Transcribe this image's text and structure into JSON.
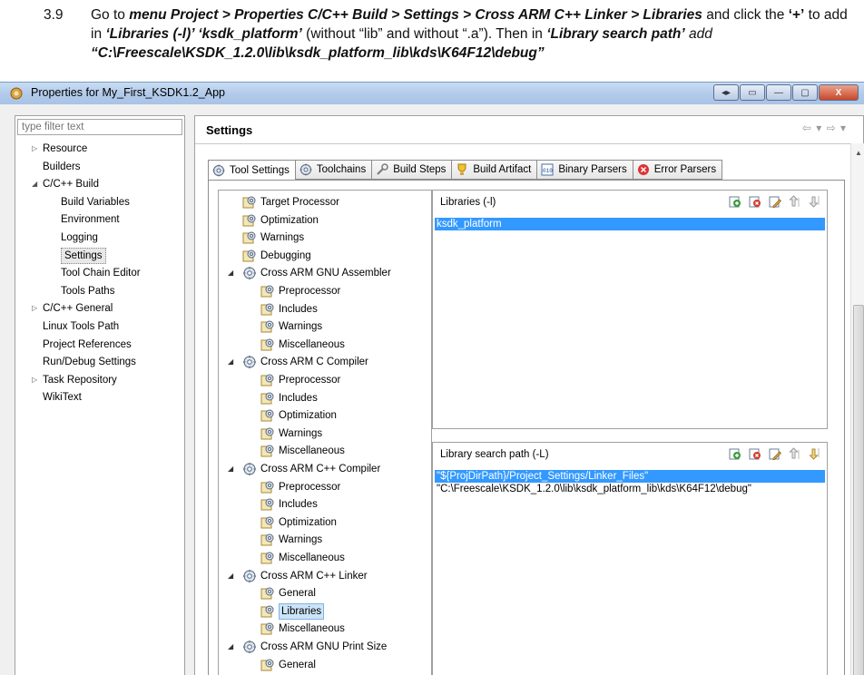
{
  "instruction": {
    "number": "3.9",
    "t1": "Go to ",
    "menu_path": "menu Project > Properties C/C++ Build > Settings > Cross ARM C++ Linker > Libraries",
    "t2": " and click the ",
    "plus": "‘+’",
    "t3": " to add in ",
    "libs_label": "‘Libraries (-l)’ ‘ksdk_platform’",
    "t4": " (without “lib” and without “.a”). Then in ",
    "search_label": "‘Library search path’",
    "t5": " add ",
    "search_value": "“C:\\Freescale\\KSDK_1.2.0\\lib\\ksdk_platform_lib\\kds\\K64F12\\debug”"
  },
  "window": {
    "title": "Properties for My_First_KSDK1.2_App",
    "buttons": [
      "◂▸",
      "▭",
      "—",
      "▢",
      "X"
    ]
  },
  "sidebar": {
    "filter_placeholder": "type filter text",
    "items": [
      {
        "label": "Resource",
        "expander": "▷"
      },
      {
        "label": "Builders",
        "expander": ""
      },
      {
        "label": "C/C++ Build",
        "expander": "◢"
      },
      {
        "label": "Build Variables",
        "expander": ""
      },
      {
        "label": "Environment",
        "expander": ""
      },
      {
        "label": "Logging",
        "expander": ""
      },
      {
        "label": "Settings",
        "expander": "",
        "selected": true
      },
      {
        "label": "Tool Chain Editor",
        "expander": ""
      },
      {
        "label": "Tools Paths",
        "expander": ""
      },
      {
        "label": "C/C++ General",
        "expander": "▷"
      },
      {
        "label": "Linux Tools Path",
        "expander": ""
      },
      {
        "label": "Project References",
        "expander": ""
      },
      {
        "label": "Run/Debug Settings",
        "expander": ""
      },
      {
        "label": "Task Repository",
        "expander": "▷"
      },
      {
        "label": "WikiText",
        "expander": ""
      }
    ]
  },
  "main": {
    "title": "Settings",
    "nav_arrows": "⇦ ▾ ⇨ ▾",
    "tabs": [
      {
        "label": "Tool Settings",
        "icon": "gear-icon"
      },
      {
        "label": "Toolchains",
        "icon": "gear-icon"
      },
      {
        "label": "Build Steps",
        "icon": "wrench-icon"
      },
      {
        "label": "Build Artifact",
        "icon": "trophy-icon"
      },
      {
        "label": "Binary Parsers",
        "icon": "binary-icon"
      },
      {
        "label": "Error Parsers",
        "icon": "error-icon"
      }
    ],
    "tree": [
      {
        "label": "Target Processor",
        "level": 0
      },
      {
        "label": "Optimization",
        "level": 0
      },
      {
        "label": "Warnings",
        "level": 0
      },
      {
        "label": "Debugging",
        "level": 0
      },
      {
        "label": "Cross ARM GNU Assembler",
        "level": 0,
        "expander": "◢",
        "tool": true
      },
      {
        "label": "Preprocessor",
        "level": 1
      },
      {
        "label": "Includes",
        "level": 1
      },
      {
        "label": "Warnings",
        "level": 1
      },
      {
        "label": "Miscellaneous",
        "level": 1
      },
      {
        "label": "Cross ARM C Compiler",
        "level": 0,
        "expander": "◢",
        "tool": true
      },
      {
        "label": "Preprocessor",
        "level": 1
      },
      {
        "label": "Includes",
        "level": 1
      },
      {
        "label": "Optimization",
        "level": 1
      },
      {
        "label": "Warnings",
        "level": 1
      },
      {
        "label": "Miscellaneous",
        "level": 1
      },
      {
        "label": "Cross ARM C++ Compiler",
        "level": 0,
        "expander": "◢",
        "tool": true
      },
      {
        "label": "Preprocessor",
        "level": 1
      },
      {
        "label": "Includes",
        "level": 1
      },
      {
        "label": "Optimization",
        "level": 1
      },
      {
        "label": "Warnings",
        "level": 1
      },
      {
        "label": "Miscellaneous",
        "level": 1
      },
      {
        "label": "Cross ARM C++ Linker",
        "level": 0,
        "expander": "◢",
        "tool": true
      },
      {
        "label": "General",
        "level": 1
      },
      {
        "label": "Libraries",
        "level": 1,
        "selected": true
      },
      {
        "label": "Miscellaneous",
        "level": 1
      },
      {
        "label": "Cross ARM GNU Print Size",
        "level": 0,
        "expander": "◢",
        "tool": true
      },
      {
        "label": "General",
        "level": 1
      }
    ],
    "libraries": {
      "title": "Libraries (-l)",
      "items": [
        "ksdk_platform"
      ]
    },
    "search_paths": {
      "title": "Library search path (-L)",
      "items": [
        "\"${ProjDirPath}/Project_Settings/Linker_Files\"",
        "\"C:\\Freescale\\KSDK_1.2.0\\lib\\ksdk_platform_lib\\kds\\K64F12\\debug\""
      ]
    }
  }
}
